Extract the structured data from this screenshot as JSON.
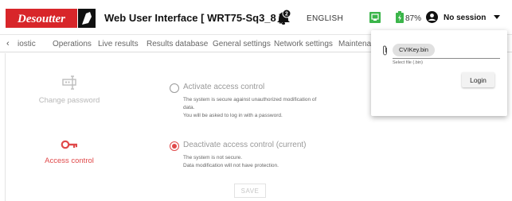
{
  "header": {
    "brand": "Desoutter",
    "title": "Web User Interface [ WRT75-Sq3_8 ]",
    "notification_count": "2",
    "language": "ENGLISH",
    "battery_pct": "87%",
    "session": "No session"
  },
  "nav": {
    "tabs": [
      "iostic",
      "Operations",
      "Live results",
      "Results database",
      "General settings",
      "Network settings",
      "Maintenanc"
    ]
  },
  "sidebar": {
    "items": [
      {
        "label": "Change password",
        "icon": "password-field-icon",
        "state": "inactive"
      },
      {
        "label": "Access control",
        "icon": "key-icon",
        "state": "active"
      }
    ]
  },
  "options": [
    {
      "title": "Activate access control",
      "selected": false,
      "lines": [
        "The system is secure against unauthorized modification of",
        "data.",
        "You will be asked to log in with a password."
      ]
    },
    {
      "title": "Deactivate access control (current)",
      "selected": true,
      "lines": [
        "The system is not secure.",
        "Data modification will not have protection."
      ]
    }
  ],
  "save_label": "SAVE",
  "login_popup": {
    "file_name": "CVIKey.bin",
    "hint": "Select file (.bin)",
    "login_label": "Login"
  },
  "colors": {
    "accent": "#e0494a",
    "network_status": "#3bb54a",
    "battery": "#3bb54a"
  }
}
